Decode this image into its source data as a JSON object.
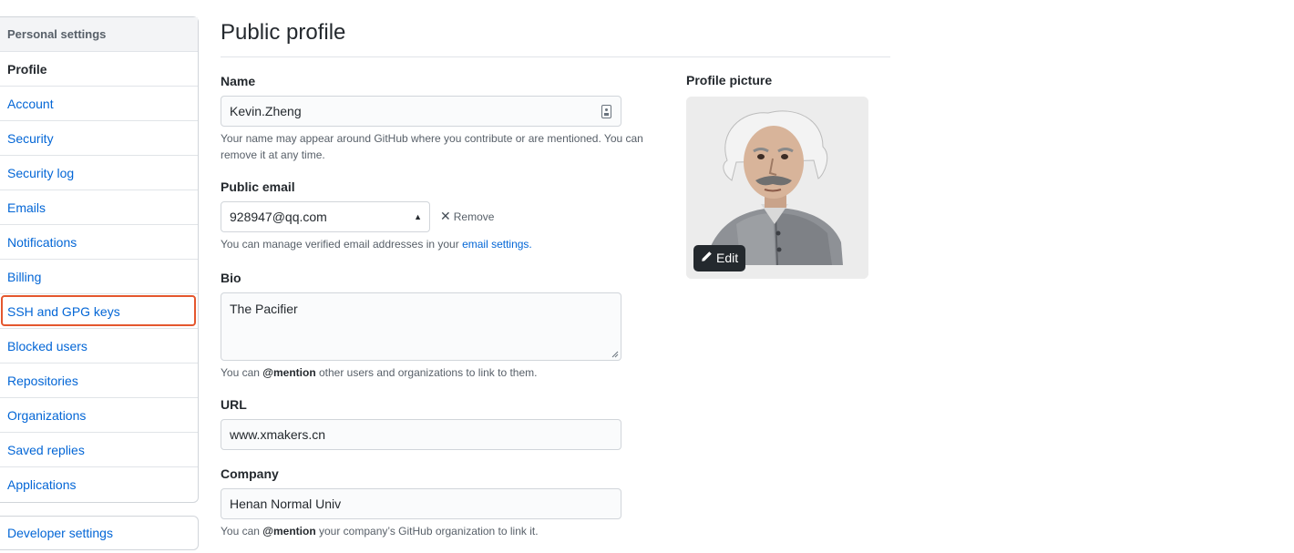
{
  "sidebar": {
    "header": "Personal settings",
    "items": [
      {
        "label": "Profile"
      },
      {
        "label": "Account"
      },
      {
        "label": "Security"
      },
      {
        "label": "Security log"
      },
      {
        "label": "Emails"
      },
      {
        "label": "Notifications"
      },
      {
        "label": "Billing"
      },
      {
        "label": "SSH and GPG keys"
      },
      {
        "label": "Blocked users"
      },
      {
        "label": "Repositories"
      },
      {
        "label": "Organizations"
      },
      {
        "label": "Saved replies"
      },
      {
        "label": "Applications"
      }
    ],
    "developer": "Developer settings"
  },
  "main": {
    "title": "Public profile",
    "name": {
      "label": "Name",
      "value": "Kevin.Zheng",
      "note_line1": "Your name may appear around GitHub where you contribute or are mentioned. You can",
      "note_line2": "remove it at any time."
    },
    "email": {
      "label": "Public email",
      "value": "928947@qq.com",
      "remove": "Remove",
      "note_prefix": "You can manage verified email addresses in your",
      "note_link": "email settings."
    },
    "bio": {
      "label": "Bio",
      "value": "The Pacifier",
      "note_prefix": "You can",
      "note_mention": "@mention",
      "note_suffix": "other users and organizations to link to them."
    },
    "url": {
      "label": "URL",
      "value": "www.xmakers.cn"
    },
    "company": {
      "label": "Company",
      "value": "Henan Normal Univ",
      "note_prefix": "You can",
      "note_mention": "@mention",
      "note_suffix": "your company’s GitHub organization to link it."
    },
    "picture": {
      "label": "Profile picture",
      "edit": "Edit"
    }
  },
  "colors": {
    "link": "#0366d6",
    "highlight": "#e4572e",
    "edit_bg": "#24292e"
  }
}
